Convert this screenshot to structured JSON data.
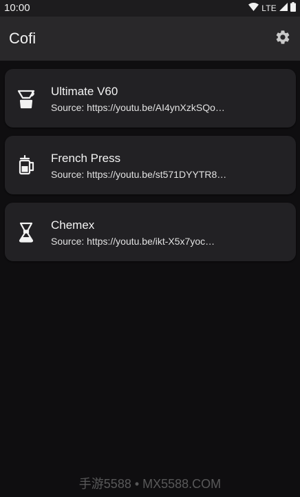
{
  "status_bar": {
    "time": "10:00",
    "network": "LTE",
    "icons": [
      "wifi-icon",
      "signal-icon",
      "battery-icon"
    ]
  },
  "app_bar": {
    "title": "Cofi",
    "action_icon": "gear-icon"
  },
  "recipes": [
    {
      "icon": "v60-dripper-icon",
      "title": "Ultimate V60",
      "source": "Source: https://youtu.be/AI4ynXzkSQo…"
    },
    {
      "icon": "french-press-icon",
      "title": "French Press",
      "source": "Source: https://youtu.be/st571DYYTR8…"
    },
    {
      "icon": "chemex-icon",
      "title": "Chemex",
      "source": "Source: https://youtu.be/ikt-X5x7yoc…"
    }
  ],
  "watermark": "手游5588 • MX5588.COM",
  "colors": {
    "background": "#0f0e10",
    "app_bar": "#29282a",
    "card": "#222124",
    "text_primary": "#f3f3f3"
  }
}
